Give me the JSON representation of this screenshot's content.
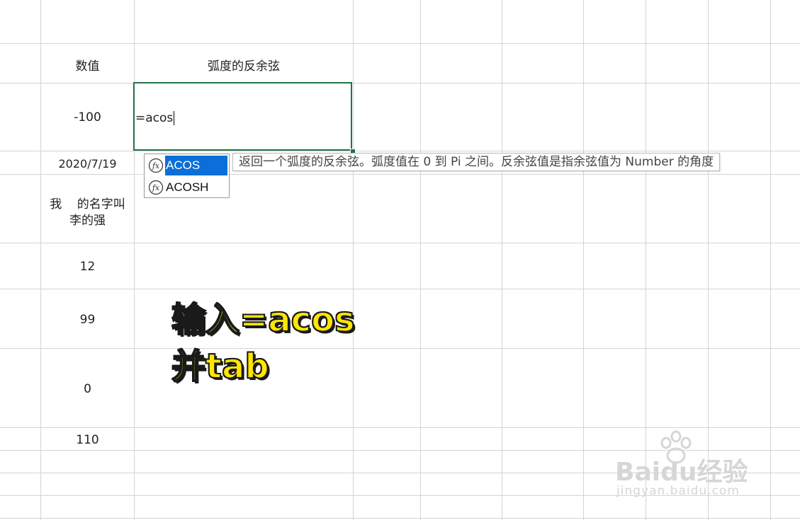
{
  "column_a": {
    "header": "数值",
    "values": [
      "-100",
      "2020/7/19",
      "我    的名字叫",
      "李的强",
      "12",
      "99",
      "0",
      "110"
    ]
  },
  "column_b": {
    "header": "弧度的反余弦"
  },
  "active_cell": {
    "formula_text": "=acos"
  },
  "autocomplete": {
    "items": [
      {
        "label": "ACOS",
        "selected": true
      },
      {
        "label": "ACOSH",
        "selected": false
      }
    ],
    "tooltip": "返回一个弧度的反余弦。弧度值在 0 到 Pi 之间。反余弦值是指余弦值为 Number 的角度"
  },
  "overlay": {
    "line1": "输入=acos",
    "line2": "并tab",
    "color": "#ffe600"
  },
  "watermark": {
    "brand": "Baidu经验",
    "url": "jingyan.baidu.com"
  },
  "colors": {
    "gridline": "#d4d4d4",
    "active_border": "#217346",
    "selection": "#0a6fd8"
  }
}
